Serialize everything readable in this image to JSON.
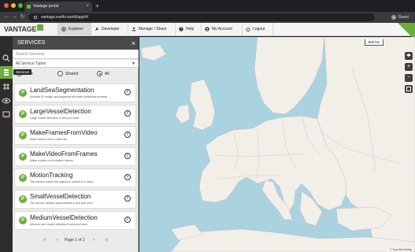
{
  "browser": {
    "tab_title": "Vantage portal",
    "tab_close": "×",
    "new_tab": "+",
    "url": "vantage.earthi.world/app/#/",
    "profile": "Guest",
    "back": "←",
    "forward": "→",
    "reload": "↻"
  },
  "app": {
    "logo": "VANTAGE",
    "nav": [
      {
        "label": "Explorer",
        "active": true
      },
      {
        "label": "Developer"
      },
      {
        "label": "Manage / Share"
      },
      {
        "label": "Help"
      },
      {
        "label": "My Account"
      },
      {
        "label": "Logout"
      }
    ],
    "accent_color": "#6cae3b",
    "rail_tooltip": "Services"
  },
  "services_panel": {
    "title": "SERVICES",
    "close": "×",
    "search_placeholder": "Search Services",
    "type_filter": "All Service Types",
    "radios": [
      {
        "label": "Mine",
        "selected": false
      },
      {
        "label": "Shared",
        "selected": false
      },
      {
        "label": "All",
        "selected": true
      }
    ],
    "items": [
      {
        "name": "LandSeaSegmentation",
        "desc": "Accepts S1 image and segments all water productive process..."
      },
      {
        "name": "LargeVesselDetection",
        "desc": "Large vessel detection in sea port area"
      },
      {
        "name": "MakeFramesFromVideo",
        "desc": "Make frames from a video file"
      },
      {
        "name": "MakeVideoFromFrames",
        "desc": "Make a video from multiple frames"
      },
      {
        "name": "MotionTracking",
        "desc": "This service tracks the objects in motion in a video"
      },
      {
        "name": "SmallVesselDetection",
        "desc": "The service detects small vessels in sea port area"
      },
      {
        "name": "MediumVesselDetection",
        "desc": "Medium size vessel detection in sea port area"
      }
    ],
    "item_icon_letter": "P",
    "info_glyph": "i",
    "pager": {
      "label": "Page 1 of 1",
      "first": "|<",
      "prev": "<",
      "next": ">",
      "last": ">|"
    }
  },
  "map": {
    "scale_label": "500 km",
    "attribution": "© OpenStreetMap",
    "zoom_in": "+",
    "zoom_out": "−"
  }
}
